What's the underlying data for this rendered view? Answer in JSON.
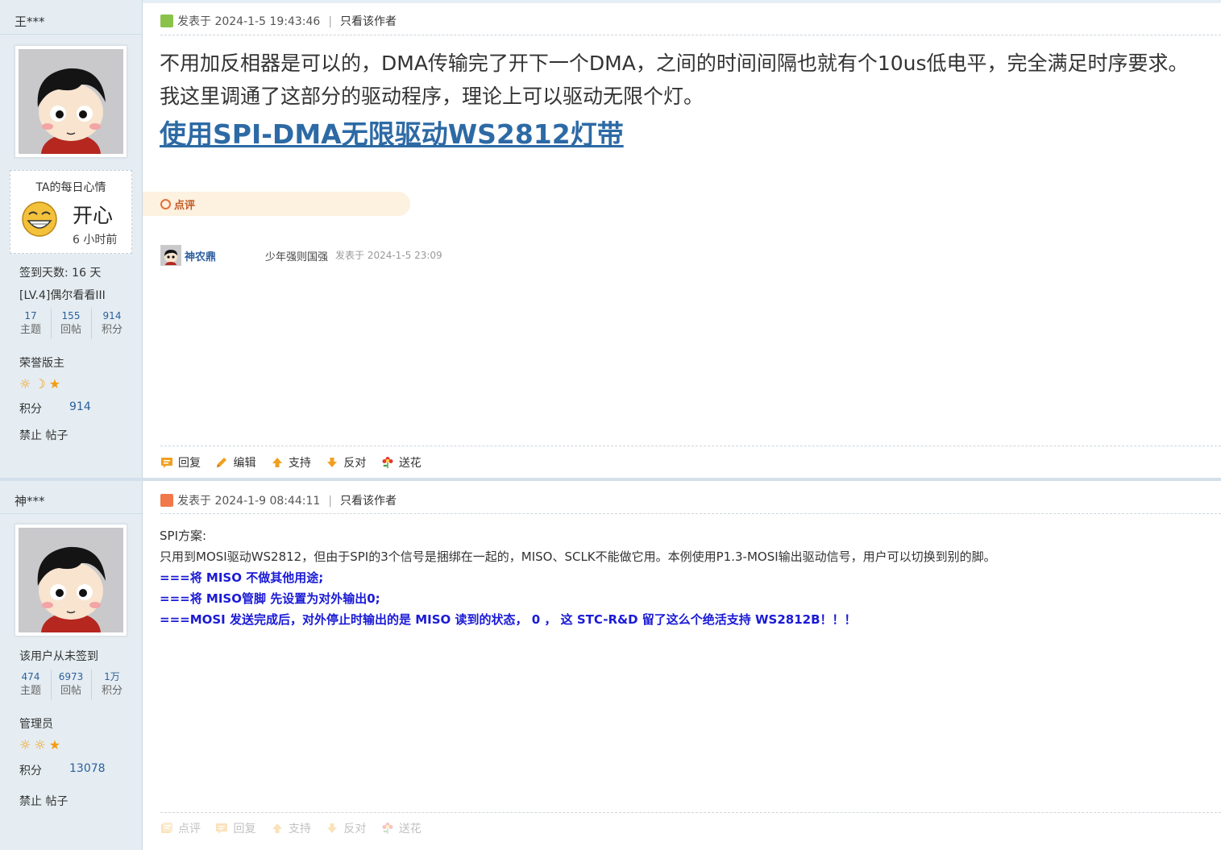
{
  "post1": {
    "author": "王***",
    "mood": {
      "title": "TA的每日心情",
      "text": "开心",
      "time": "6 小时前"
    },
    "checkin": "签到天数: 16 天",
    "level": "[LV.4]偶尔看看III",
    "stats": [
      {
        "value": "17",
        "label": "主题"
      },
      {
        "value": "155",
        "label": "回帖"
      },
      {
        "value": "914",
        "label": "积分"
      }
    ],
    "group": "荣誉版主",
    "score_label": "积分",
    "score_value": "914",
    "ban": "禁止 帖子",
    "posted": "发表于 2024-1-5 19:43:46",
    "only_author": "只看该作者",
    "body_lines": [
      "不用加反相器是可以的，DMA传输完了开下一个DMA，之间的时间间隔也就有个10us低电平，完全满足时序要求。",
      "我这里调通了这部分的驱动程序，理论上可以驱动无限个灯。"
    ],
    "link_text": "使用SPI-DMA无限驱动WS2812灯带",
    "review_label": "点评",
    "comment": {
      "name": "神农鼎",
      "text": "少年强则国强",
      "time": "发表于 2024-1-5 23:09"
    },
    "actions": [
      "回复",
      "编辑",
      "支持",
      "反对",
      "送花"
    ]
  },
  "post2": {
    "author": "神***",
    "checkin": "该用户从未签到",
    "stats": [
      {
        "value": "474",
        "label": "主题"
      },
      {
        "value": "6973",
        "label": "回帖"
      },
      {
        "value": "1万",
        "label": "积分"
      }
    ],
    "group": "管理员",
    "score_label": "积分",
    "score_value": "13078",
    "ban": "禁止 帖子",
    "posted": "发表于 2024-1-9 08:44:11",
    "only_author": "只看该作者",
    "lines": [
      "SPI方案:",
      "只用到MOSI驱动WS2812，但由于SPI的3个信号是捆绑在一起的，MISO、SCLK不能做它用。本例使用P1.3-MOSI输出驱动信号，用户可以切换到别的脚。"
    ],
    "blue_lines": [
      "===将 MISO 不做其他用途;",
      "===将 MISO管脚 先设置为对外输出0;",
      "===MOSI 发送完成后，对外停止时输出的是 MISO 读到的状态， 0 ， 这 STC-R&D 留了这么个绝活支持 WS2812B！！！"
    ],
    "actions": [
      "点评",
      "回复",
      "支持",
      "反对",
      "送花"
    ]
  },
  "colors": {
    "sidebar_bg": "#e5edf2",
    "link_blue": "#2d6aa5",
    "emphasis_blue": "#1a1ad6",
    "review_orange": "#c25a26"
  }
}
